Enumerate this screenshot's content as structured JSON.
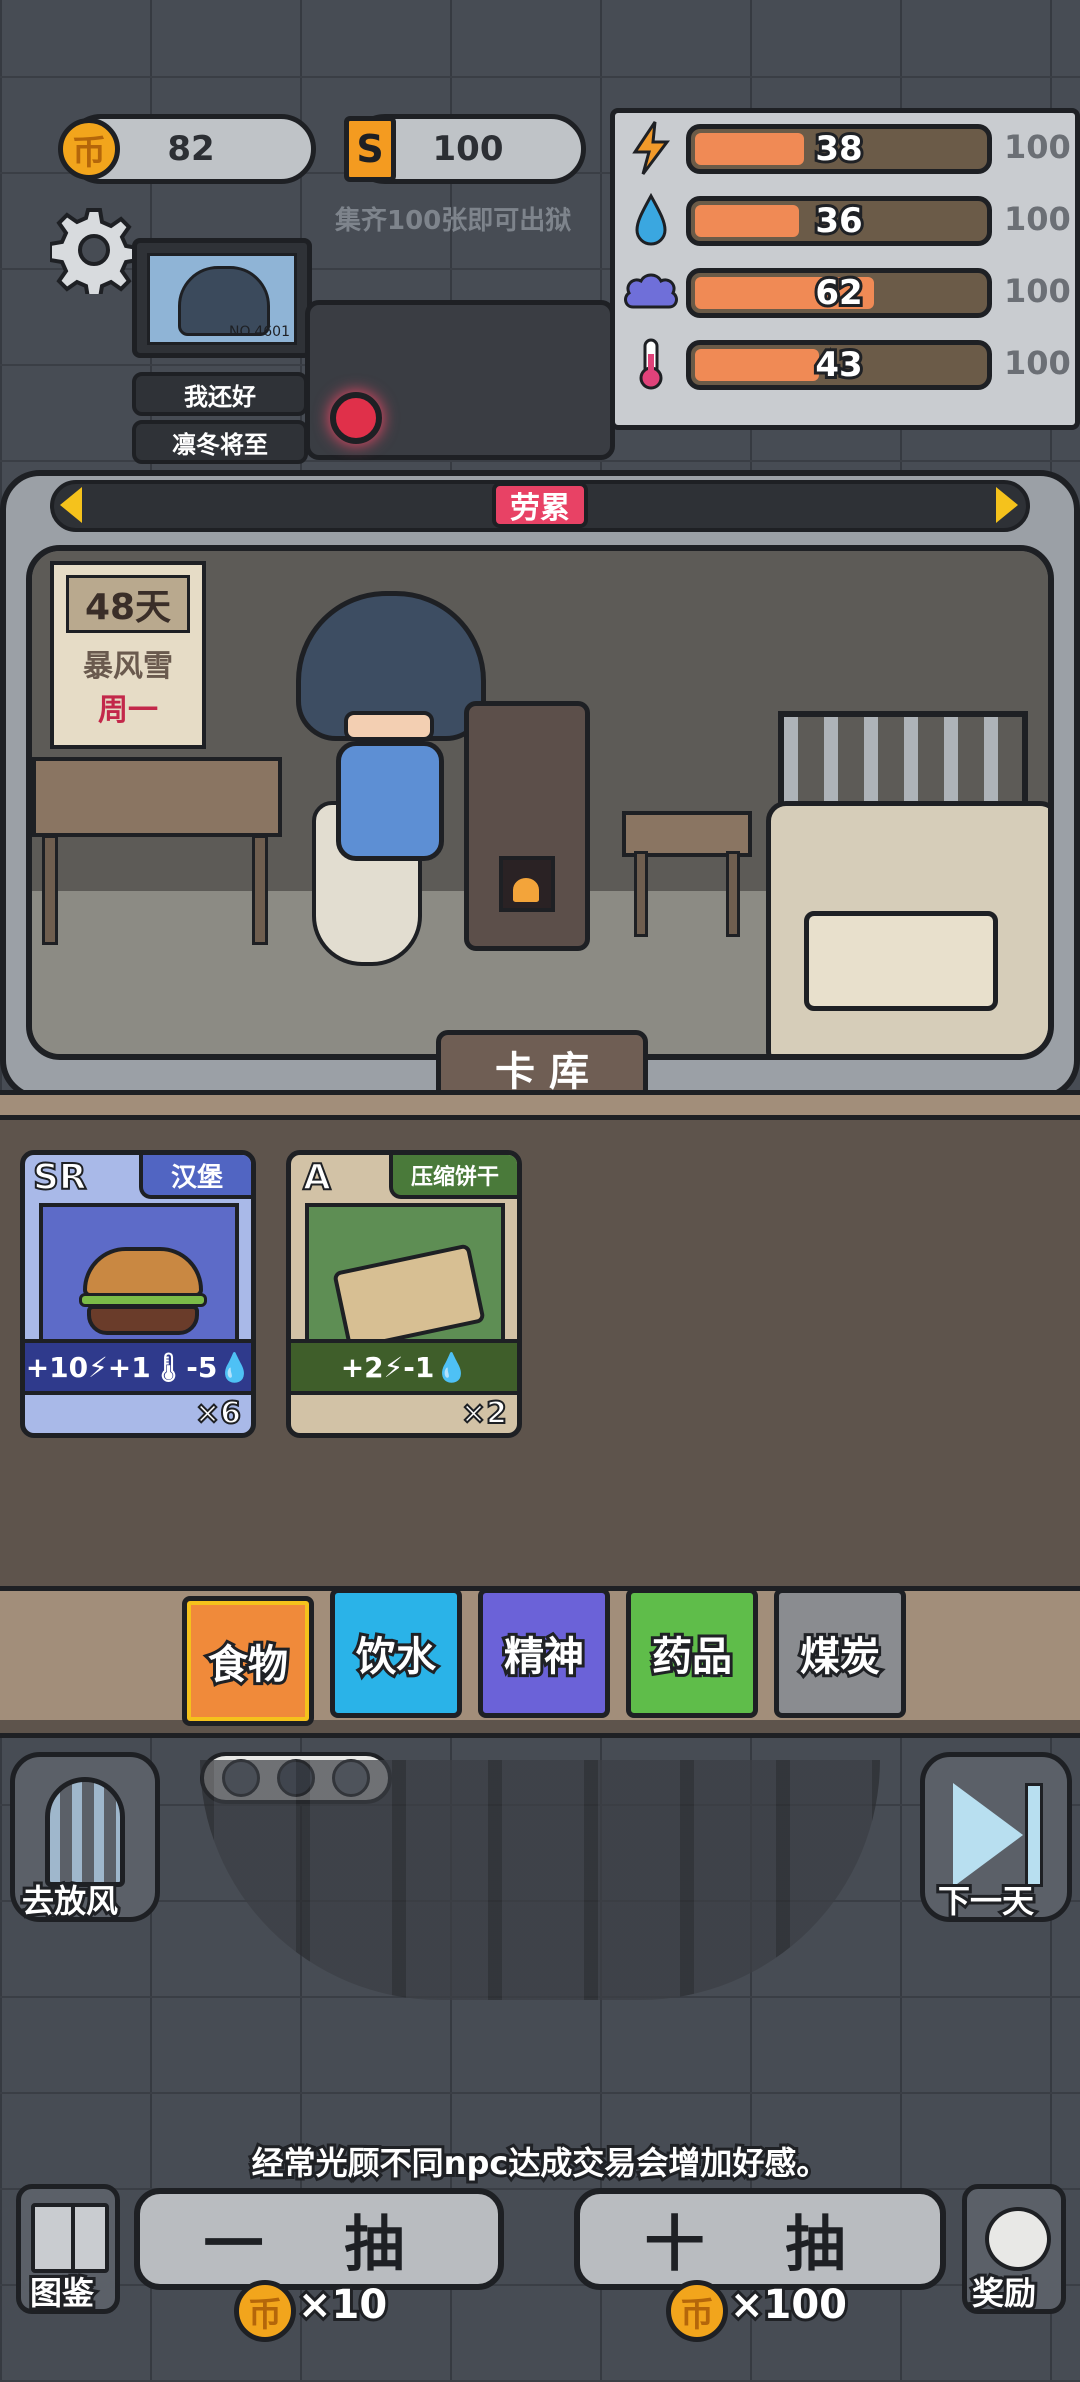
{
  "currency": {
    "coins": "82",
    "tickets": "100",
    "tickets_hint": "集齐100张即可出狱"
  },
  "icons": {
    "coin_glyph": "币",
    "ticket_glyph": "S"
  },
  "stats": [
    {
      "name": "energy",
      "value": "38",
      "max": "100",
      "fraction": 0.38,
      "color": "#f29a2a"
    },
    {
      "name": "water",
      "value": "36",
      "max": "100",
      "fraction": 0.36,
      "color": "#3aa7e0"
    },
    {
      "name": "mind",
      "value": "62",
      "max": "100",
      "fraction": 0.62,
      "color": "#6f6fd9"
    },
    {
      "name": "temperature",
      "value": "43",
      "max": "100",
      "fraction": 0.43,
      "color": "#e0427a"
    }
  ],
  "character": {
    "id": "NO.4601",
    "status_1": "我还好",
    "status_2": "凛冬将至"
  },
  "scene": {
    "state_label": "劳累",
    "day": "48天",
    "weather": "暴风雪",
    "weekday": "周一",
    "inventory_title": "卡 库"
  },
  "cards": [
    {
      "rarity": "SR",
      "name": "汉堡",
      "effects": "+10⚡+1🌡-5💧",
      "count": "×6",
      "bg": "#8b9ad6"
    },
    {
      "rarity": "A",
      "name": "压缩饼干",
      "effects": "+2⚡-1💧",
      "count": "×2",
      "bg": "#c9b79a"
    }
  ],
  "categories": [
    {
      "label": "食物",
      "color": "#f08a3a",
      "active": true
    },
    {
      "label": "饮水",
      "color": "#2ab3e8",
      "active": false
    },
    {
      "label": "精神",
      "color": "#6b62d8",
      "active": false
    },
    {
      "label": "药品",
      "color": "#5fbd4a",
      "active": false
    },
    {
      "label": "煤炭",
      "color": "#8a8c90",
      "active": false
    }
  ],
  "actions": {
    "go_out": "去放风",
    "next_day": "下一天",
    "gallery": "图鉴",
    "reward": "奖励"
  },
  "tip": "经常光顾不同npc达成交易会增加好感。",
  "draw": {
    "single_label": "一 抽",
    "single_cost": "×10",
    "ten_label": "十 抽",
    "ten_cost": "×100"
  }
}
